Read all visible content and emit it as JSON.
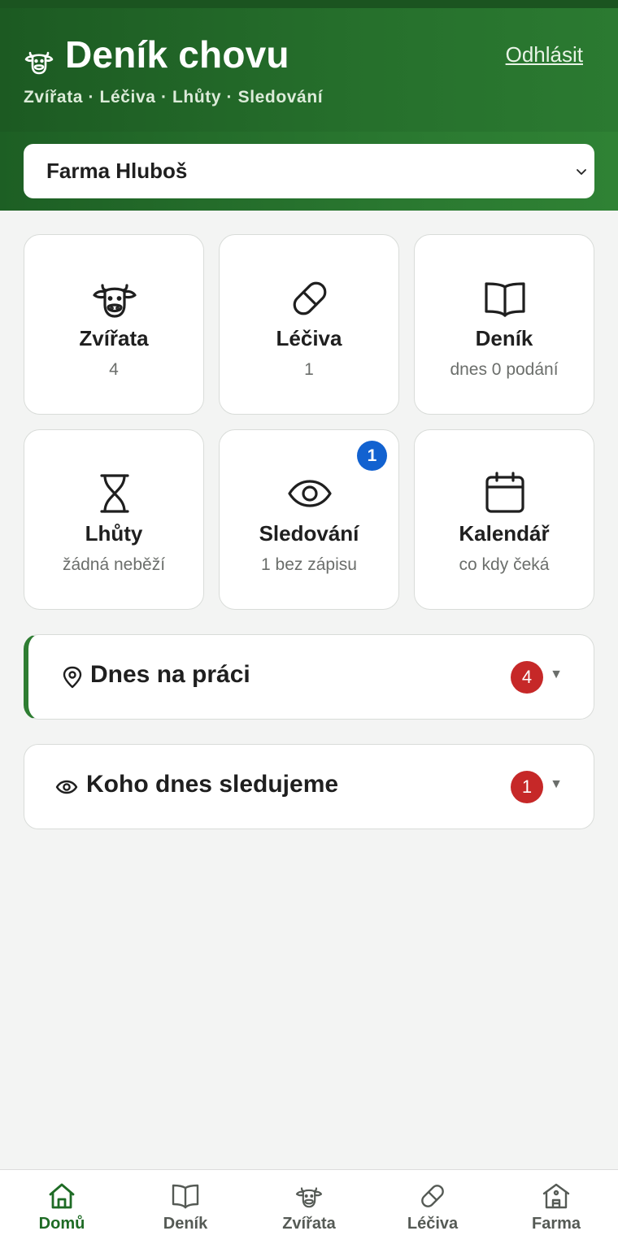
{
  "header": {
    "title": "Deník chovu",
    "subtitle": "Zvířata · Léčiva · Lhůty · Sledování",
    "logout_label": "Odhlásit"
  },
  "farm_select": {
    "value": "Farma Hluboš"
  },
  "tiles": [
    {
      "label": "Zvířata",
      "sub": "4",
      "icon": "cow-icon"
    },
    {
      "label": "Léčiva",
      "sub": "1",
      "icon": "pill-icon"
    },
    {
      "label": "Deník",
      "sub": "dnes 0 podání",
      "icon": "book-icon"
    },
    {
      "label": "Lhůty",
      "sub": "žádná neběží",
      "icon": "hourglass-icon"
    },
    {
      "label": "Sledování",
      "sub": "1 bez zápisu",
      "icon": "eye-icon",
      "badge": "1"
    },
    {
      "label": "Kalendář",
      "sub": "co kdy čeká",
      "icon": "calendar-icon"
    }
  ],
  "sections": [
    {
      "title": "Dnes na práci",
      "count": "4",
      "icon": "map-pin-icon"
    },
    {
      "title": "Koho dnes sledujeme",
      "count": "1",
      "icon": "eye-icon"
    }
  ],
  "caret_glyph": "▼",
  "bottom_nav": [
    {
      "label": "Domů",
      "icon": "home-icon",
      "active": true
    },
    {
      "label": "Deník",
      "icon": "book-icon"
    },
    {
      "label": "Zvířata",
      "icon": "cow-icon"
    },
    {
      "label": "Léčiva",
      "icon": "pill-icon"
    },
    {
      "label": "Farma",
      "icon": "barn-icon"
    }
  ],
  "colors": {
    "header_green": "#2b7a31",
    "active_nav": "#1e6b25",
    "badge_blue": "#1262d0",
    "badge_red": "#c62828"
  }
}
